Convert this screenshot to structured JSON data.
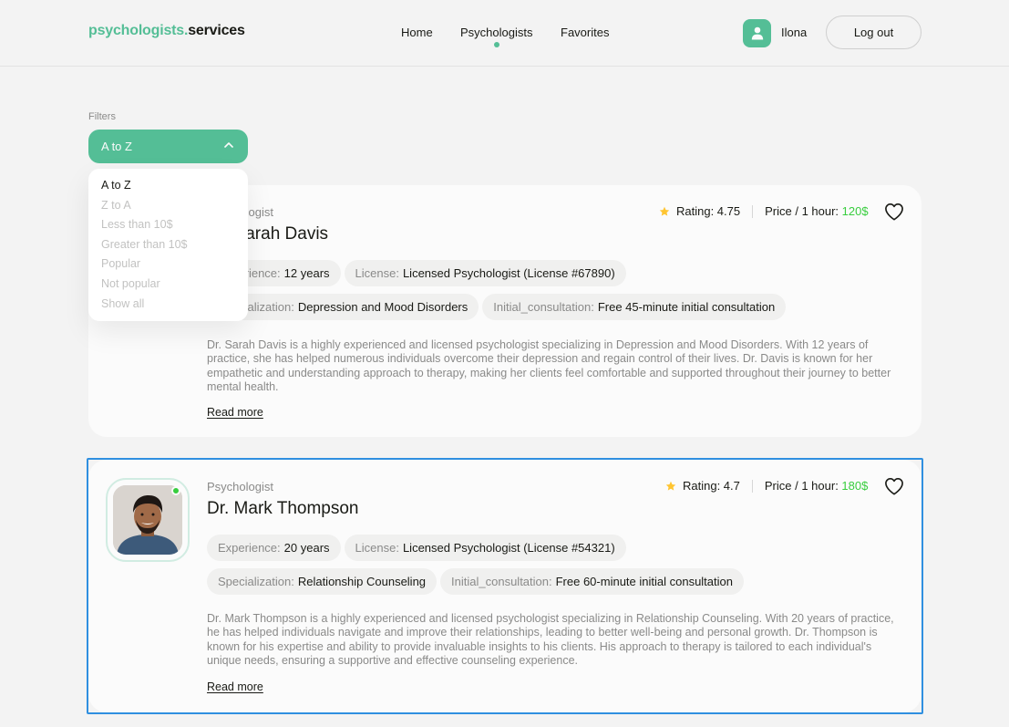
{
  "header": {
    "logo_part1": "psychologists.",
    "logo_part2": "services",
    "nav": {
      "home": "Home",
      "psychologists": "Psychologists",
      "favorites": "Favorites"
    },
    "user": {
      "name": "Ilona",
      "avatar_icon": "user-icon"
    },
    "logout_label": "Log out",
    "accent_color": "#54be96"
  },
  "filters": {
    "label": "Filters",
    "selected": "A to Z",
    "options": [
      "A to Z",
      "Z to A",
      "Less than 10$",
      "Greater than 10$",
      "Popular",
      "Not popular",
      "Show all"
    ]
  },
  "psychologists": [
    {
      "role": "Psychologist",
      "name": "Dr. Sarah Davis",
      "rating_label": "Rating: 4.75",
      "price_label": "Price / 1 hour: ",
      "price_value": "120$",
      "experience_label": "Experience:",
      "experience": "12 years",
      "license_label": "License:",
      "license": "Licensed Psychologist (License #67890)",
      "specialization_label": "Specialization:",
      "specialization": "Depression and Mood Disorders",
      "consultation_label": "Initial_consultation:",
      "consultation": "Free 45-minute initial consultation",
      "about": "Dr. Sarah Davis is a highly experienced and licensed psychologist specializing in Depression and Mood Disorders. With 12 years of practice, she has helped numerous individuals overcome their depression and regain control of their lives. Dr. Davis is known for her empathetic and understanding approach to therapy, making her clients feel comfortable and supported throughout their journey to better mental health.",
      "read_more": "Read more"
    },
    {
      "role": "Psychologist",
      "name": "Dr. Mark Thompson",
      "rating_label": "Rating: 4.7",
      "price_label": "Price / 1 hour: ",
      "price_value": "180$",
      "experience_label": "Experience:",
      "experience": "20 years",
      "license_label": "License:",
      "license": "Licensed Psychologist (License #54321)",
      "specialization_label": "Specialization:",
      "specialization": "Relationship Counseling",
      "consultation_label": "Initial_consultation:",
      "consultation": "Free 60-minute initial consultation",
      "about": "Dr. Mark Thompson is a highly experienced and licensed psychologist specializing in Relationship Counseling. With 20 years of practice, he has helped individuals navigate and improve their relationships, leading to better well-being and personal growth. Dr. Thompson is known for his expertise and ability to provide invaluable insights to his clients. His approach to therapy is tailored to each individual's unique needs, ensuring a supportive and effective counseling experience.",
      "read_more": "Read more"
    }
  ]
}
